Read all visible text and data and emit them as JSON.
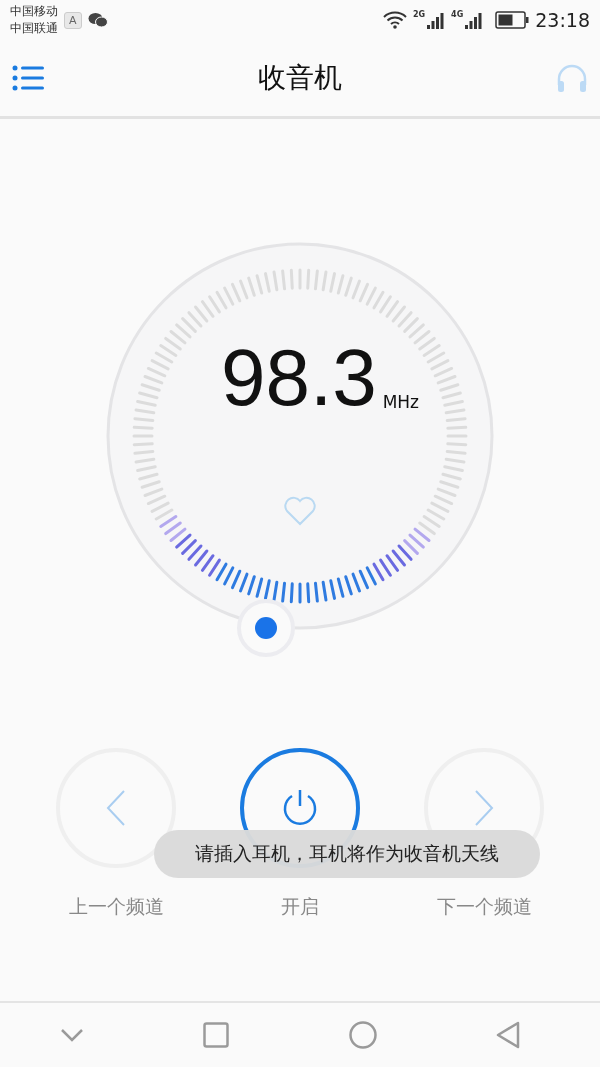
{
  "status_bar": {
    "carriers": [
      "中国移动",
      "中国联通"
    ],
    "keyboard_badge": "A",
    "time": "23:18",
    "network_labels": [
      "2G",
      "4G"
    ]
  },
  "header": {
    "title": "收音机"
  },
  "dial": {
    "frequency": "98.3",
    "unit": "MHz",
    "favorite": false
  },
  "controls": [
    {
      "kind": "prev",
      "label": "上一个频道",
      "active": false
    },
    {
      "kind": "power",
      "label": "开启",
      "active": true
    },
    {
      "kind": "next",
      "label": "下一个频道",
      "active": false
    }
  ],
  "toast": {
    "text": "请插入耳机，耳机将作为收音机天线"
  }
}
